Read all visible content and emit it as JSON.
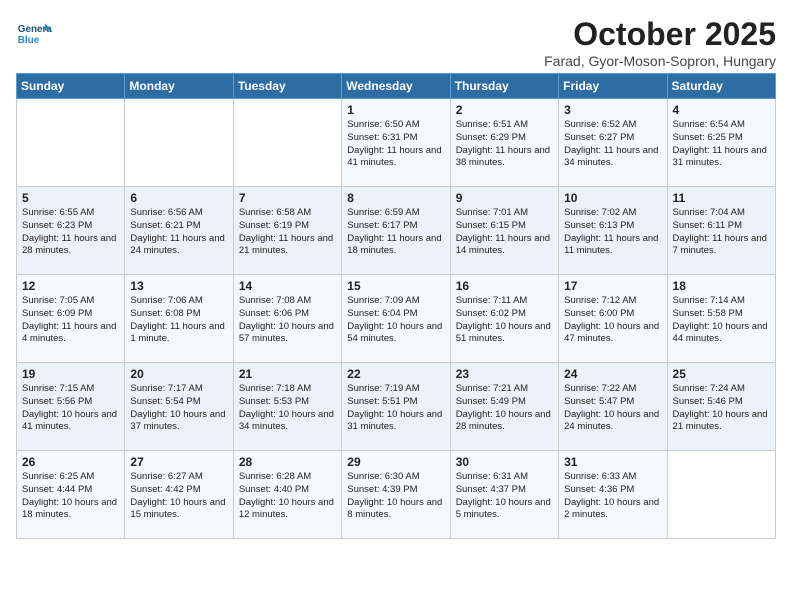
{
  "header": {
    "logo_line1": "General",
    "logo_line2": "Blue",
    "month": "October 2025",
    "location": "Farad, Gyor-Moson-Sopron, Hungary"
  },
  "weekdays": [
    "Sunday",
    "Monday",
    "Tuesday",
    "Wednesday",
    "Thursday",
    "Friday",
    "Saturday"
  ],
  "weeks": [
    [
      {
        "day": "",
        "text": ""
      },
      {
        "day": "",
        "text": ""
      },
      {
        "day": "",
        "text": ""
      },
      {
        "day": "1",
        "text": "Sunrise: 6:50 AM\nSunset: 6:31 PM\nDaylight: 11 hours and 41 minutes."
      },
      {
        "day": "2",
        "text": "Sunrise: 6:51 AM\nSunset: 6:29 PM\nDaylight: 11 hours and 38 minutes."
      },
      {
        "day": "3",
        "text": "Sunrise: 6:52 AM\nSunset: 6:27 PM\nDaylight: 11 hours and 34 minutes."
      },
      {
        "day": "4",
        "text": "Sunrise: 6:54 AM\nSunset: 6:25 PM\nDaylight: 11 hours and 31 minutes."
      }
    ],
    [
      {
        "day": "5",
        "text": "Sunrise: 6:55 AM\nSunset: 6:23 PM\nDaylight: 11 hours and 28 minutes."
      },
      {
        "day": "6",
        "text": "Sunrise: 6:56 AM\nSunset: 6:21 PM\nDaylight: 11 hours and 24 minutes."
      },
      {
        "day": "7",
        "text": "Sunrise: 6:58 AM\nSunset: 6:19 PM\nDaylight: 11 hours and 21 minutes."
      },
      {
        "day": "8",
        "text": "Sunrise: 6:59 AM\nSunset: 6:17 PM\nDaylight: 11 hours and 18 minutes."
      },
      {
        "day": "9",
        "text": "Sunrise: 7:01 AM\nSunset: 6:15 PM\nDaylight: 11 hours and 14 minutes."
      },
      {
        "day": "10",
        "text": "Sunrise: 7:02 AM\nSunset: 6:13 PM\nDaylight: 11 hours and 11 minutes."
      },
      {
        "day": "11",
        "text": "Sunrise: 7:04 AM\nSunset: 6:11 PM\nDaylight: 11 hours and 7 minutes."
      }
    ],
    [
      {
        "day": "12",
        "text": "Sunrise: 7:05 AM\nSunset: 6:09 PM\nDaylight: 11 hours and 4 minutes."
      },
      {
        "day": "13",
        "text": "Sunrise: 7:06 AM\nSunset: 6:08 PM\nDaylight: 11 hours and 1 minute."
      },
      {
        "day": "14",
        "text": "Sunrise: 7:08 AM\nSunset: 6:06 PM\nDaylight: 10 hours and 57 minutes."
      },
      {
        "day": "15",
        "text": "Sunrise: 7:09 AM\nSunset: 6:04 PM\nDaylight: 10 hours and 54 minutes."
      },
      {
        "day": "16",
        "text": "Sunrise: 7:11 AM\nSunset: 6:02 PM\nDaylight: 10 hours and 51 minutes."
      },
      {
        "day": "17",
        "text": "Sunrise: 7:12 AM\nSunset: 6:00 PM\nDaylight: 10 hours and 47 minutes."
      },
      {
        "day": "18",
        "text": "Sunrise: 7:14 AM\nSunset: 5:58 PM\nDaylight: 10 hours and 44 minutes."
      }
    ],
    [
      {
        "day": "19",
        "text": "Sunrise: 7:15 AM\nSunset: 5:56 PM\nDaylight: 10 hours and 41 minutes."
      },
      {
        "day": "20",
        "text": "Sunrise: 7:17 AM\nSunset: 5:54 PM\nDaylight: 10 hours and 37 minutes."
      },
      {
        "day": "21",
        "text": "Sunrise: 7:18 AM\nSunset: 5:53 PM\nDaylight: 10 hours and 34 minutes."
      },
      {
        "day": "22",
        "text": "Sunrise: 7:19 AM\nSunset: 5:51 PM\nDaylight: 10 hours and 31 minutes."
      },
      {
        "day": "23",
        "text": "Sunrise: 7:21 AM\nSunset: 5:49 PM\nDaylight: 10 hours and 28 minutes."
      },
      {
        "day": "24",
        "text": "Sunrise: 7:22 AM\nSunset: 5:47 PM\nDaylight: 10 hours and 24 minutes."
      },
      {
        "day": "25",
        "text": "Sunrise: 7:24 AM\nSunset: 5:46 PM\nDaylight: 10 hours and 21 minutes."
      }
    ],
    [
      {
        "day": "26",
        "text": "Sunrise: 6:25 AM\nSunset: 4:44 PM\nDaylight: 10 hours and 18 minutes."
      },
      {
        "day": "27",
        "text": "Sunrise: 6:27 AM\nSunset: 4:42 PM\nDaylight: 10 hours and 15 minutes."
      },
      {
        "day": "28",
        "text": "Sunrise: 6:28 AM\nSunset: 4:40 PM\nDaylight: 10 hours and 12 minutes."
      },
      {
        "day": "29",
        "text": "Sunrise: 6:30 AM\nSunset: 4:39 PM\nDaylight: 10 hours and 8 minutes."
      },
      {
        "day": "30",
        "text": "Sunrise: 6:31 AM\nSunset: 4:37 PM\nDaylight: 10 hours and 5 minutes."
      },
      {
        "day": "31",
        "text": "Sunrise: 6:33 AM\nSunset: 4:36 PM\nDaylight: 10 hours and 2 minutes."
      },
      {
        "day": "",
        "text": ""
      }
    ]
  ]
}
